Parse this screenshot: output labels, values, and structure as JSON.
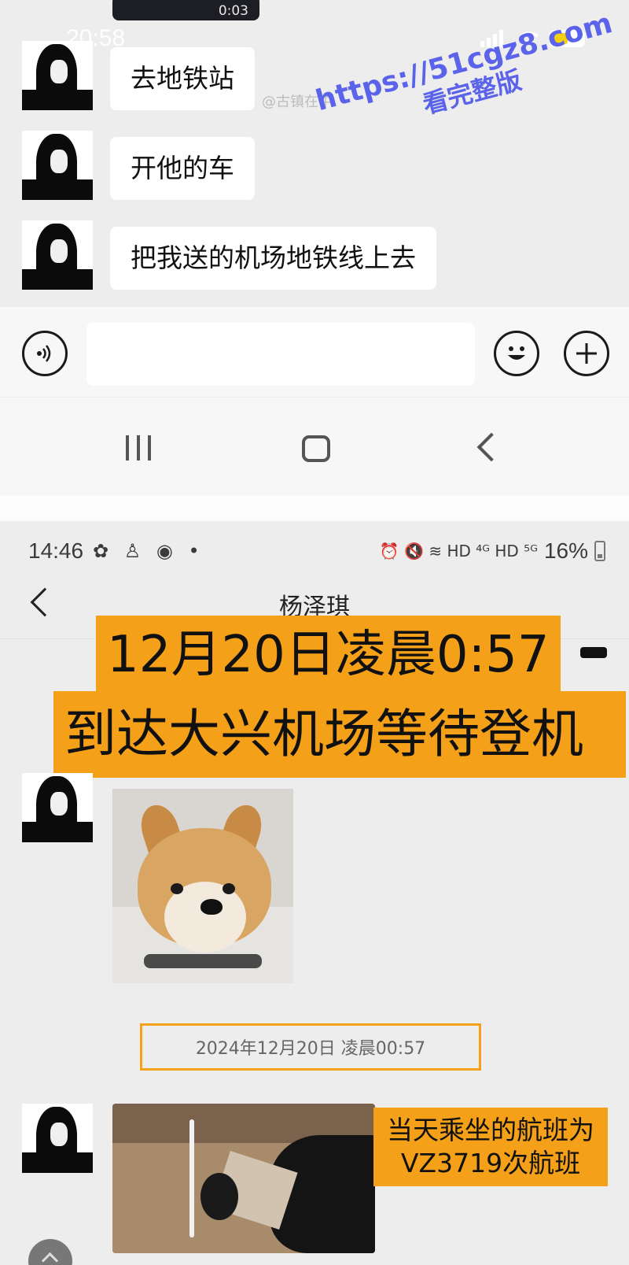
{
  "top": {
    "video_duration": "0:03",
    "status_time": "20:58",
    "messages": [
      {
        "text": "去地铁站"
      },
      {
        "text": "开他的车"
      },
      {
        "text": "把我送的机场地铁线上去"
      }
    ],
    "weibo_mark": "@古镇在中",
    "watermark_url": "https://51cgz8.com",
    "watermark_text": "看完整版",
    "icons": {
      "voice": "voice-icon",
      "emoji": "emoji-icon",
      "plus": "plus-icon",
      "nav_recent": "recent-apps-icon",
      "nav_home": "home-icon",
      "nav_back": "back-icon"
    }
  },
  "bottom": {
    "status_time": "14:46",
    "status_left_icons": "✿ ♙ ◉ •",
    "status_right_icons": "⏰ 🔇 ≋ HD ⁴ᴳ HD ⁵ᴳ",
    "battery_percent": "16%",
    "chat_title": "杨泽琪",
    "caption_line1": "12月20日凌晨0:57",
    "caption_line2": "到达大兴机场等待登机",
    "date_stamp": "2024年12月20日 凌晨00:57",
    "flight_caption_line1": "当天乘坐的航班为",
    "flight_caption_line2": "VZ3719次航班",
    "highlight_color": "#f5a019"
  }
}
